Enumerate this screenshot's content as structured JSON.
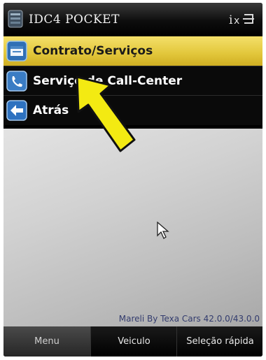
{
  "window": {
    "title": "IDC4 POCKET"
  },
  "menu": {
    "items": [
      {
        "label": "Contrato/Serviços",
        "icon": "document-window-icon",
        "selected": true
      },
      {
        "label": "Serviço de Call-Center",
        "icon": "phone-icon",
        "selected": false
      },
      {
        "label": "Atrás",
        "icon": "back-arrow-icon",
        "selected": false
      }
    ]
  },
  "status": {
    "version": "Mareli By Texa Cars 42.0.0/43.0.0"
  },
  "softkeys": {
    "menu": "Menu",
    "vehicle": "Veiculo",
    "quick": "Seleção rápida"
  },
  "colors": {
    "selected_bg": "#e6c93c",
    "annotation_arrow": "#f3ea12"
  }
}
